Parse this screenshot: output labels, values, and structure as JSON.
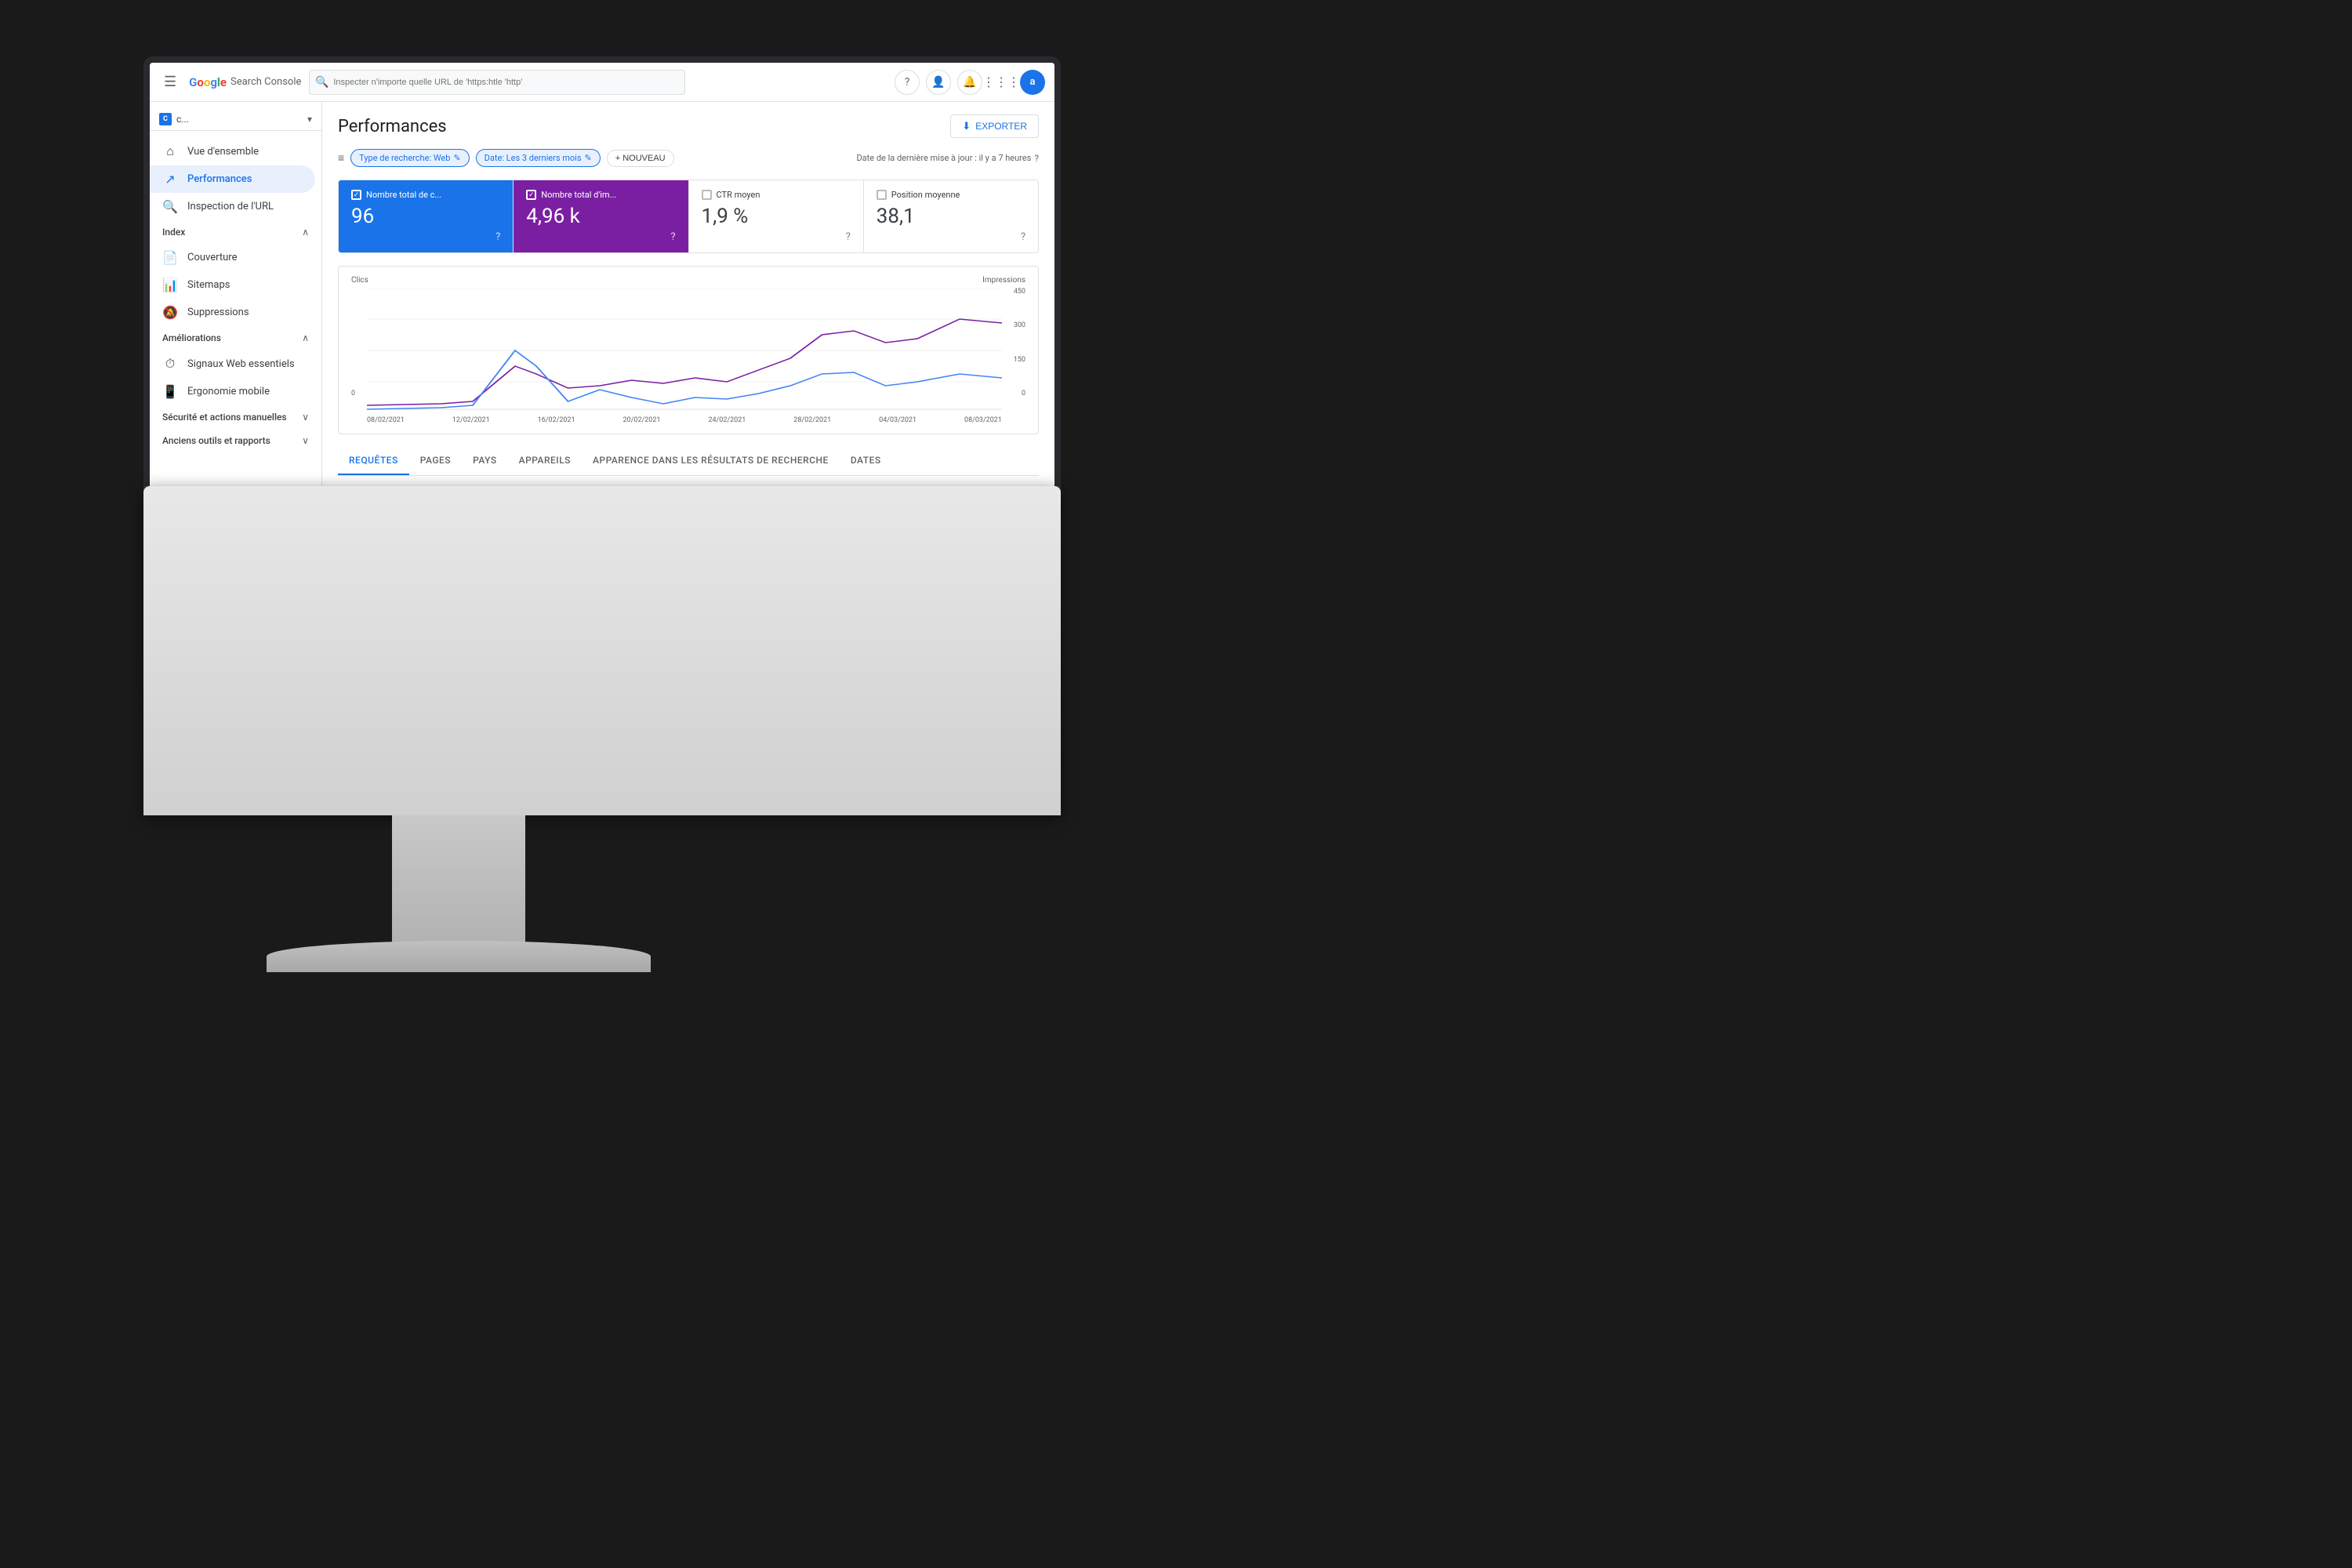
{
  "app": {
    "title": "Google Search Console",
    "brand": {
      "g1": "G",
      "o1": "o",
      "o2": "o",
      "g2": "g",
      "l": "l",
      "e": "e",
      "search": " Search",
      "console": "Console"
    }
  },
  "header": {
    "search_placeholder": "Inspecter n'importe quelle URL de 'https:htle 'http'",
    "export_label": "EXPORTER"
  },
  "site_selector": {
    "icon": "C",
    "name": "c...",
    "dropdown_arrow": "▾"
  },
  "sidebar": {
    "items": [
      {
        "id": "vue-ensemble",
        "label": "Vue d'ensemble",
        "icon": "⌂"
      },
      {
        "id": "performances",
        "label": "Performances",
        "icon": "↗"
      },
      {
        "id": "inspection-url",
        "label": "Inspection de l'URL",
        "icon": "🔍"
      }
    ],
    "index_section": {
      "label": "Index",
      "items": [
        {
          "id": "couverture",
          "label": "Couverture",
          "icon": "📄"
        },
        {
          "id": "sitemaps",
          "label": "Sitemaps",
          "icon": "📊"
        },
        {
          "id": "suppressions",
          "label": "Suppressions",
          "icon": "🔕"
        }
      ]
    },
    "ameliorations_section": {
      "label": "Améliorations",
      "items": [
        {
          "id": "signaux-web",
          "label": "Signaux Web essentiels",
          "icon": "⏱"
        },
        {
          "id": "ergonomie",
          "label": "Ergonomie mobile",
          "icon": "📱"
        }
      ]
    },
    "securite_section": {
      "label": "Sécurité et actions manuelles"
    },
    "anciens_section": {
      "label": "Anciens outils et rapports"
    }
  },
  "content": {
    "page_title": "Performances",
    "filters": {
      "filter_icon": "≡",
      "chip1": "Type de recherche: Web ✎",
      "chip2": "Date: Les 3 derniers mois ✎",
      "add_label": "+ NOUVEAU",
      "update_info": "Date de la dernière mise à jour : il y a 7 heures",
      "info_icon": "?"
    },
    "metrics": [
      {
        "id": "clics",
        "label": "Nombre total de c...",
        "value": "96",
        "active": "blue",
        "checked": true
      },
      {
        "id": "impressions",
        "label": "Nombre total d'im...",
        "value": "4,96 k",
        "active": "purple",
        "checked": true
      },
      {
        "id": "ctr",
        "label": "CTR moyen",
        "value": "1,9 %",
        "active": false,
        "checked": false
      },
      {
        "id": "position",
        "label": "Position moyenne",
        "value": "38,1",
        "active": false,
        "checked": false
      }
    ],
    "chart": {
      "left_label": "Clics",
      "right_label": "Impressions",
      "right_max": "450",
      "right_150": "150",
      "right_300": "300",
      "left_0": "0",
      "left_0b": "0",
      "x_labels": [
        "08/02/2021",
        "12/02/2021",
        "16/02/2021",
        "20/02/2021",
        "24/02/2021",
        "28/02/2021",
        "04/03/2021",
        "08/03/2021"
      ]
    },
    "tabs": [
      {
        "id": "requetes",
        "label": "REQUÊTES",
        "active": true
      },
      {
        "id": "pages",
        "label": "PAGES",
        "active": false
      },
      {
        "id": "pays",
        "label": "PAYS",
        "active": false
      },
      {
        "id": "appareils",
        "label": "APPAREILS",
        "active": false
      },
      {
        "id": "apparence",
        "label": "APPARENCE DANS LES RÉSULTATS DE RECHERCHE",
        "active": false
      },
      {
        "id": "dates",
        "label": "DATES",
        "active": false
      }
    ]
  },
  "monitor": {
    "apple_logo": ""
  }
}
